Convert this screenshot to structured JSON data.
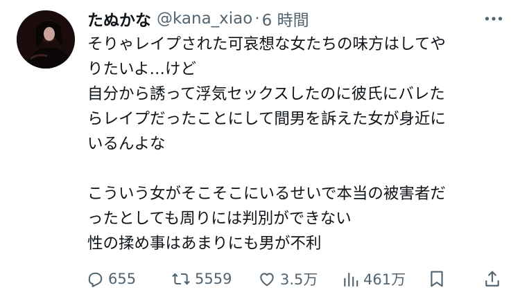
{
  "author": {
    "display_name": "たぬかな",
    "handle": "@kana_xiao",
    "separator": "·",
    "time": "6 時間"
  },
  "tweet": {
    "lines": [
      "そりゃレイプされた可哀想な女たちの味方はしてや",
      "りたいよ…けど",
      "自分から誘って浮気セックスしたのに彼氏にバレた",
      "らレイプだったことにして間男を訴えた女が身近に",
      "いるんよな",
      "",
      "こういう女がそこそこにいるせいで本当の被害者だ",
      "ったとしても周りには判別ができない",
      "性の揉め事はあまりにも男が不利"
    ]
  },
  "actions": {
    "reply_count": "655",
    "retweet_count": "5559",
    "like_count": "3.5万",
    "view_count": "461万"
  },
  "icons": {
    "more": "more-icon",
    "reply": "reply-icon",
    "retweet": "retweet-icon",
    "like": "heart-icon",
    "views": "analytics-icon",
    "bookmark": "bookmark-icon",
    "share": "share-icon"
  },
  "colors": {
    "text": "#0f1419",
    "secondary": "#536471"
  }
}
